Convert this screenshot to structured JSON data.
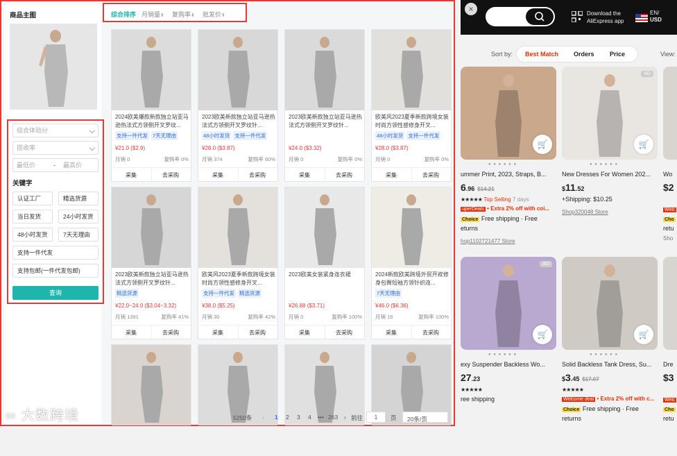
{
  "sidebar": {
    "title": "商品主图",
    "filters": {
      "select1_placeholder": "综合体验分",
      "select2_placeholder": "揽收率",
      "price_min_placeholder": "最低价",
      "price_sep": "-",
      "price_max_placeholder": "最高价"
    },
    "keywords_title": "关键字",
    "tags": [
      "认证工厂",
      "精选货源",
      "当日发货",
      "24小时发货",
      "48小时发货",
      "7天无理由",
      "支持一件代发",
      "支持包邮(一件代发包邮)"
    ],
    "search_label": "查询"
  },
  "sortbar": {
    "items": [
      {
        "label": "综合排序",
        "active": true
      },
      {
        "label": "月销量",
        "arrow": "⬍"
      },
      {
        "label": "复购率",
        "arrow": "⬍"
      },
      {
        "label": "批发价",
        "arrow": "⬍"
      }
    ]
  },
  "products": [
    {
      "title": "2024欧美爆款新款独立站亚马逊热法式方领侧开叉罗纹...",
      "tags": [
        "支持一件代发",
        "7天无理由"
      ],
      "price": "¥21.0 ($2.9)",
      "sales": "月销 0",
      "repurchase": "复购率 0%",
      "img_color": "#dcdcdc"
    },
    {
      "title": "2023欧美新款独立站亚马逊热法式方领侧开叉罗纹针...",
      "tags": [
        "48小时发货",
        "支持一件代发"
      ],
      "price": "¥28.0 ($3.87)",
      "sales": "月销 374",
      "repurchase": "复购率 60%",
      "img_color": "#d8d8d8"
    },
    {
      "title": "2023欧美新款独立站亚马逊热法式方领侧开叉罗纹针...",
      "tags": [],
      "price": "¥24.0 ($3.32)",
      "sales": "月销 0",
      "repurchase": "复购率 0%",
      "img_color": "#dadada"
    },
    {
      "title": "欧美风2023夏季新款跨境女装时尚方领性感修身开叉...",
      "tags": [
        "48小时发货",
        "支持一件代发"
      ],
      "price": "¥28.0 ($3.87)",
      "sales": "月销 0",
      "repurchase": "复购率 0%",
      "img_color": "#e2e0dc"
    },
    {
      "title": "2023欧美新款独立站亚马逊热法式方领侧开叉罗纹针...",
      "tags": [
        "精选货源"
      ],
      "price": "¥22.0~24.0 ($3.04~3.32)",
      "sales": "月销 1391",
      "repurchase": "复购率 41%",
      "img_color": "#d6d6d6"
    },
    {
      "title": "欧美风2023夏季新款跨境女装时尚方领性感修身开叉...",
      "tags": [
        "支持一件代发",
        "精选货源"
      ],
      "price": "¥38.0 ($5.25)",
      "sales": "月销 30",
      "repurchase": "复购率 42%",
      "img_color": "#e4e1dc"
    },
    {
      "title": "2023欧美女装紧身连衣裙",
      "tags": [],
      "price": "¥26.88 ($3.71)",
      "sales": "月销 0",
      "repurchase": "复购率 100%",
      "img_color": "#e8e8e8"
    },
    {
      "title": "2024新款欧美跨境外贸开衩修身包臀短袖方领针织连...",
      "tags": [
        "7天无理由"
      ],
      "price": "¥46.0 ($6.36)",
      "sales": "月销 16",
      "repurchase": "复购率 100%",
      "img_color": "#efece6"
    },
    {
      "title": "",
      "tags": [],
      "price": "",
      "sales": "",
      "repurchase": "",
      "img_color": "#d9d4cf"
    },
    {
      "title": "",
      "tags": [],
      "price": "",
      "sales": "",
      "repurchase": "",
      "img_color": "#dcdcdc"
    },
    {
      "title": "",
      "tags": [],
      "price": "",
      "sales": "",
      "repurchase": "",
      "img_color": "#e0e0e0"
    },
    {
      "title": "",
      "tags": [],
      "price": "",
      "sales": "",
      "repurchase": "",
      "img_color": "#d4d4d4"
    }
  ],
  "card_buttons": {
    "collect": "采集",
    "buy": "去采购"
  },
  "pager": {
    "total": "5250条",
    "prev": "‹",
    "pages": [
      "1",
      "2",
      "3",
      "4",
      "•••",
      "263"
    ],
    "next": "›",
    "goto": "前往",
    "page_input": "1",
    "page_unit": "页",
    "size": "20条/页"
  },
  "watermark": "大数跨境",
  "aliexpress": {
    "close": "×",
    "download_line1": "Download the",
    "download_line2": "AliExpress app",
    "lang": "EN/",
    "currency": "USD",
    "sort_label": "Sort by:",
    "sort_options": [
      "Best Match",
      "Orders",
      "Price"
    ],
    "view_label": "View:",
    "cards": [
      {
        "title": "ummer Print, 2023, Straps, B...",
        "price_main": "6",
        "price_cents": ".96",
        "old_price": "$14.21",
        "rating_text": "Top Selling",
        "rating_extra": "7 days",
        "promo_badge": "uperDeals",
        "promo_text": "• Extra 2% off with coi...",
        "choice": "Choice",
        "ship_text": "Free shipping · Free",
        "ship_line2": "eturns",
        "store": "hop1102721477 Store",
        "img_color": "#c9a88c",
        "ad": ""
      },
      {
        "title": "New Dresses For Women 202...",
        "price_prefix": "$",
        "price_main": "11",
        "price_cents": ".52",
        "old_price": "",
        "rating_text": "",
        "rating_extra": "",
        "promo_badge": "",
        "promo_text": "",
        "choice": "",
        "ship_text": "+Shipping: $10.25",
        "ship_line2": "",
        "store": "Shop320048 Store",
        "img_color": "#e9e6e2",
        "ad": "AD"
      },
      {
        "title": "exy Suspender Backless Wo...",
        "price_main": "27",
        "price_cents": ".23",
        "old_price": "",
        "rating_text": "",
        "rating_extra": "",
        "promo_badge": "",
        "promo_text": "",
        "choice": "",
        "ship_text": "ree shipping",
        "ship_line2": "",
        "store": "",
        "img_color": "#b9a8cf",
        "ad": "AD"
      },
      {
        "title": "Solid Backless Tank Dress, Su...",
        "price_prefix": "$",
        "price_main": "3",
        "price_cents": ".45",
        "old_price": "$17.07",
        "rating_text": "",
        "rating_extra": "",
        "promo_badge": "Welcome deal",
        "promo_text": "• Extra 2% off with c...",
        "choice": "Choice",
        "ship_text": "Free shipping · Free",
        "ship_line2": "returns",
        "store": "",
        "img_color": "#cfcac4",
        "ad": ""
      }
    ],
    "edge_cards": [
      {
        "title": "Wo",
        "price": "$2",
        "badge": "Welc",
        "choice": "Cho",
        "line": "retu",
        "store": "Sho"
      },
      {
        "title": "Dre",
        "price": "$3",
        "badge": "Welc",
        "choice": "Cho",
        "line": "retu",
        "store": ""
      }
    ]
  }
}
